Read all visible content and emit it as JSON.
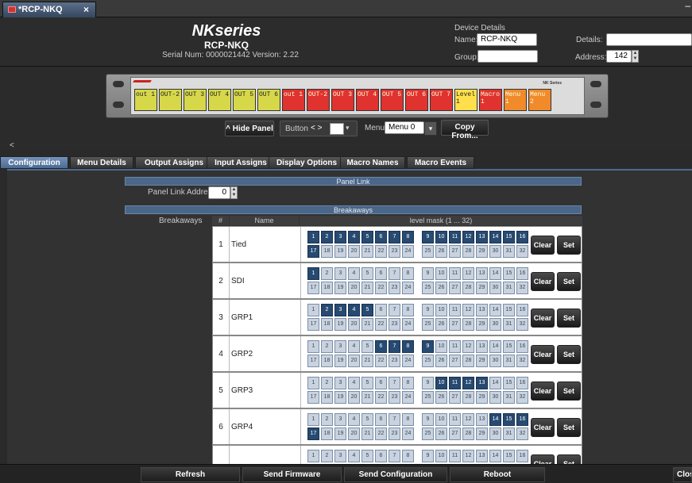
{
  "window": {
    "tab_title": "*RCP-NKQ",
    "close_glyph": "×",
    "min_glyph": "–"
  },
  "header": {
    "brand": "NKseries",
    "device": "RCP-NKQ",
    "serial_line": "Serial Num: 0000021442   Version: 2.22",
    "device_details_heading": "Device Details",
    "name_label": "Name:",
    "name_value": "RCP-NKQ",
    "details_label": "Details:",
    "details_value": "",
    "group_label": "Group:",
    "group_value": "",
    "address_label": "Address:",
    "address_value": "142"
  },
  "panel": {
    "keys": [
      {
        "label": "out 1",
        "color": "y"
      },
      {
        "label": "OUT-2",
        "color": "y"
      },
      {
        "label": "OUT 3",
        "color": "y"
      },
      {
        "label": "OUT 4",
        "color": "y"
      },
      {
        "label": "OUT 5",
        "color": "y"
      },
      {
        "label": "OUT 6",
        "color": "y"
      },
      {
        "label": "out 1",
        "color": "r"
      },
      {
        "label": "OUT-2",
        "color": "r"
      },
      {
        "label": "OUT 3",
        "color": "r"
      },
      {
        "label": "OUT 4",
        "color": "r"
      },
      {
        "label": "OUT 5",
        "color": "r"
      },
      {
        "label": "OUT 6",
        "color": "r"
      },
      {
        "label": "OUT 7",
        "color": "r"
      },
      {
        "label": "Level 1",
        "color": "ly"
      },
      {
        "label": "Macro 1",
        "color": "r"
      },
      {
        "label": "Menu 1",
        "color": "o"
      },
      {
        "label": "Menu 2",
        "color": "o"
      }
    ],
    "brand_tag": "NK Series",
    "hide_panel": "^ Hide Panel",
    "button_label": "Button",
    "button_arrows": "< >",
    "menu_label": "Menu",
    "menu_value": "Menu 0",
    "copy_from": "Copy From...",
    "left_arrow": "<"
  },
  "tabs": [
    {
      "label": "Configuration",
      "active": true
    },
    {
      "label": "Menu Details"
    },
    {
      "label": "Output Assigns"
    },
    {
      "label": "Input Assigns"
    },
    {
      "label": "Display Options"
    },
    {
      "label": "Macro Names"
    },
    {
      "label": "Macro Events"
    }
  ],
  "config": {
    "panel_link_heading": "Panel Link",
    "panel_link_address_label": "Panel Link Address",
    "panel_link_address_value": "0",
    "breakaways_heading": "Breakaways",
    "breakaways_label": "Breakaways",
    "col_num": "#",
    "col_name": "Name",
    "col_mask": "level mask (1 ... 32)",
    "clear_label": "Clear",
    "set_label": "Set",
    "rows": [
      {
        "num": "1",
        "name": "Tied",
        "on": [
          1,
          2,
          3,
          4,
          5,
          6,
          7,
          8,
          9,
          10,
          11,
          12,
          13,
          14,
          15,
          16,
          17
        ]
      },
      {
        "num": "2",
        "name": "SDI",
        "on": [
          1
        ]
      },
      {
        "num": "3",
        "name": "GRP1",
        "on": [
          2,
          3,
          4,
          5
        ]
      },
      {
        "num": "4",
        "name": "GRP2",
        "on": [
          6,
          7,
          8,
          9
        ]
      },
      {
        "num": "5",
        "name": "GRP3",
        "on": [
          10,
          11,
          12,
          13
        ]
      },
      {
        "num": "6",
        "name": "GRP4",
        "on": [
          14,
          15,
          16,
          17
        ]
      },
      {
        "num": "",
        "name": "",
        "on": []
      }
    ]
  },
  "bottom": {
    "refresh": "Refresh",
    "send_firmware": "Send Firmware",
    "send_configuration": "Send Configuration",
    "reboot": "Reboot",
    "close": "Clos"
  }
}
